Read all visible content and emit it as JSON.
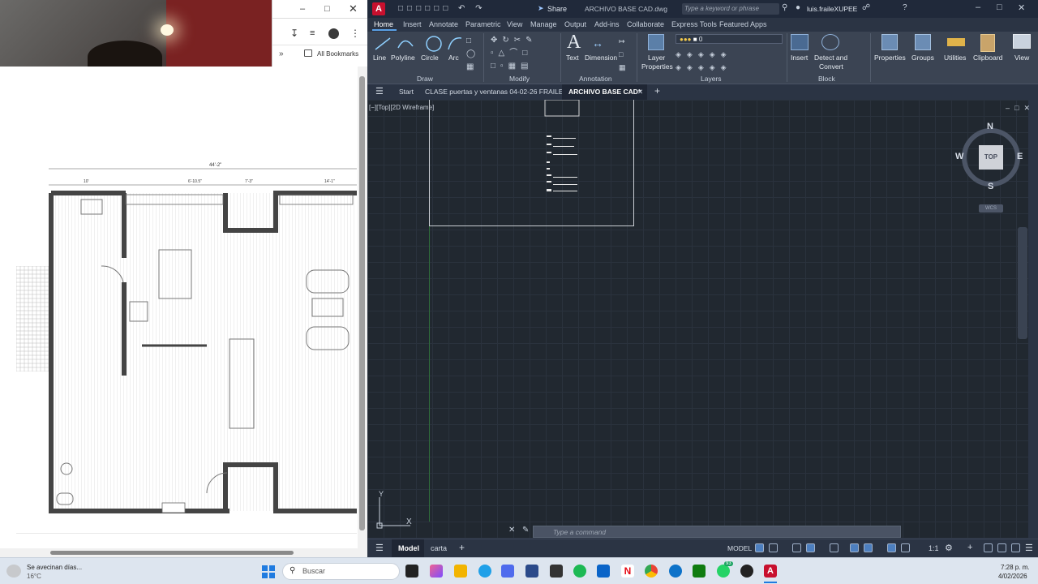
{
  "browser": {
    "bookmarks_label": "All Bookmarks"
  },
  "autocad": {
    "file_title": "ARCHIVO BASE CAD.dwg",
    "search_placeholder": "Type a keyword or phrase",
    "share_label": "Share",
    "user": "luis.fraileXUPEE",
    "ribbon_tabs": [
      "Home",
      "Insert",
      "Annotate",
      "Parametric",
      "View",
      "Manage",
      "Output",
      "Add-ins",
      "Collaborate",
      "Express Tools",
      "Featured Apps"
    ],
    "draw_tools": [
      "Line",
      "Polyline",
      "Circle",
      "Arc"
    ],
    "annotation_tools": [
      "Text",
      "Dimension"
    ],
    "layer_props_line1": "Layer",
    "layer_props_line2": "Properties",
    "layer_current": "0",
    "block_tools": {
      "insert": "Insert",
      "detect_line1": "Detect and",
      "detect_line2": "Convert"
    },
    "right_tools": [
      "Properties",
      "Groups",
      "Utilities",
      "Clipboard",
      "View"
    ],
    "panel_titles": {
      "draw": "Draw",
      "modify": "Modify",
      "annotation": "Annotation",
      "layers": "Layers",
      "block": "Block"
    },
    "doc_tabs": [
      "Start",
      "CLASE puertas y ventanas 04-02-26 FRAILE*",
      "ARCHIVO BASE CAD*"
    ],
    "viewport_label": "[−][Top][2D Wireframe]",
    "viewcube": {
      "n": "N",
      "s": "S",
      "e": "E",
      "w": "W",
      "top": "TOP",
      "wcs": "WCS"
    },
    "ucs": {
      "y": "Y",
      "x": "X"
    },
    "command_placeholder": "Type a command",
    "layout_tabs": [
      "Model",
      "carta"
    ],
    "status_model": "MODEL",
    "scale": "1:1"
  },
  "taskbar": {
    "weather_text": "Se avecinan días...",
    "temperature": "16°C",
    "search_placeholder": "Buscar",
    "time": "7:28 p. m.",
    "date": "4/02/2026",
    "whatsapp_badge": "93"
  },
  "plan_dims": {
    "overall": "44'-2\"",
    "d1": "10'",
    "d2": "6'-10.5\"",
    "d3": "7'-3\"",
    "d4": "14'-1\""
  }
}
